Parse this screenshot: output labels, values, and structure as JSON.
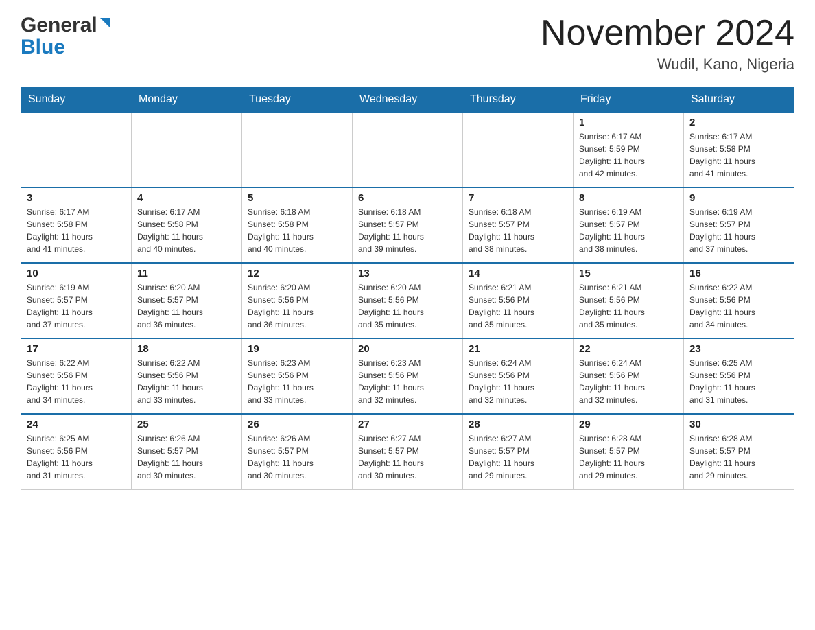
{
  "header": {
    "logo_general": "General",
    "logo_blue": "Blue",
    "title": "November 2024",
    "location": "Wudil, Kano, Nigeria"
  },
  "days_of_week": [
    "Sunday",
    "Monday",
    "Tuesday",
    "Wednesday",
    "Thursday",
    "Friday",
    "Saturday"
  ],
  "weeks": [
    {
      "days": [
        {
          "number": "",
          "info": ""
        },
        {
          "number": "",
          "info": ""
        },
        {
          "number": "",
          "info": ""
        },
        {
          "number": "",
          "info": ""
        },
        {
          "number": "",
          "info": ""
        },
        {
          "number": "1",
          "info": "Sunrise: 6:17 AM\nSunset: 5:59 PM\nDaylight: 11 hours\nand 42 minutes."
        },
        {
          "number": "2",
          "info": "Sunrise: 6:17 AM\nSunset: 5:58 PM\nDaylight: 11 hours\nand 41 minutes."
        }
      ]
    },
    {
      "days": [
        {
          "number": "3",
          "info": "Sunrise: 6:17 AM\nSunset: 5:58 PM\nDaylight: 11 hours\nand 41 minutes."
        },
        {
          "number": "4",
          "info": "Sunrise: 6:17 AM\nSunset: 5:58 PM\nDaylight: 11 hours\nand 40 minutes."
        },
        {
          "number": "5",
          "info": "Sunrise: 6:18 AM\nSunset: 5:58 PM\nDaylight: 11 hours\nand 40 minutes."
        },
        {
          "number": "6",
          "info": "Sunrise: 6:18 AM\nSunset: 5:57 PM\nDaylight: 11 hours\nand 39 minutes."
        },
        {
          "number": "7",
          "info": "Sunrise: 6:18 AM\nSunset: 5:57 PM\nDaylight: 11 hours\nand 38 minutes."
        },
        {
          "number": "8",
          "info": "Sunrise: 6:19 AM\nSunset: 5:57 PM\nDaylight: 11 hours\nand 38 minutes."
        },
        {
          "number": "9",
          "info": "Sunrise: 6:19 AM\nSunset: 5:57 PM\nDaylight: 11 hours\nand 37 minutes."
        }
      ]
    },
    {
      "days": [
        {
          "number": "10",
          "info": "Sunrise: 6:19 AM\nSunset: 5:57 PM\nDaylight: 11 hours\nand 37 minutes."
        },
        {
          "number": "11",
          "info": "Sunrise: 6:20 AM\nSunset: 5:57 PM\nDaylight: 11 hours\nand 36 minutes."
        },
        {
          "number": "12",
          "info": "Sunrise: 6:20 AM\nSunset: 5:56 PM\nDaylight: 11 hours\nand 36 minutes."
        },
        {
          "number": "13",
          "info": "Sunrise: 6:20 AM\nSunset: 5:56 PM\nDaylight: 11 hours\nand 35 minutes."
        },
        {
          "number": "14",
          "info": "Sunrise: 6:21 AM\nSunset: 5:56 PM\nDaylight: 11 hours\nand 35 minutes."
        },
        {
          "number": "15",
          "info": "Sunrise: 6:21 AM\nSunset: 5:56 PM\nDaylight: 11 hours\nand 35 minutes."
        },
        {
          "number": "16",
          "info": "Sunrise: 6:22 AM\nSunset: 5:56 PM\nDaylight: 11 hours\nand 34 minutes."
        }
      ]
    },
    {
      "days": [
        {
          "number": "17",
          "info": "Sunrise: 6:22 AM\nSunset: 5:56 PM\nDaylight: 11 hours\nand 34 minutes."
        },
        {
          "number": "18",
          "info": "Sunrise: 6:22 AM\nSunset: 5:56 PM\nDaylight: 11 hours\nand 33 minutes."
        },
        {
          "number": "19",
          "info": "Sunrise: 6:23 AM\nSunset: 5:56 PM\nDaylight: 11 hours\nand 33 minutes."
        },
        {
          "number": "20",
          "info": "Sunrise: 6:23 AM\nSunset: 5:56 PM\nDaylight: 11 hours\nand 32 minutes."
        },
        {
          "number": "21",
          "info": "Sunrise: 6:24 AM\nSunset: 5:56 PM\nDaylight: 11 hours\nand 32 minutes."
        },
        {
          "number": "22",
          "info": "Sunrise: 6:24 AM\nSunset: 5:56 PM\nDaylight: 11 hours\nand 32 minutes."
        },
        {
          "number": "23",
          "info": "Sunrise: 6:25 AM\nSunset: 5:56 PM\nDaylight: 11 hours\nand 31 minutes."
        }
      ]
    },
    {
      "days": [
        {
          "number": "24",
          "info": "Sunrise: 6:25 AM\nSunset: 5:56 PM\nDaylight: 11 hours\nand 31 minutes."
        },
        {
          "number": "25",
          "info": "Sunrise: 6:26 AM\nSunset: 5:57 PM\nDaylight: 11 hours\nand 30 minutes."
        },
        {
          "number": "26",
          "info": "Sunrise: 6:26 AM\nSunset: 5:57 PM\nDaylight: 11 hours\nand 30 minutes."
        },
        {
          "number": "27",
          "info": "Sunrise: 6:27 AM\nSunset: 5:57 PM\nDaylight: 11 hours\nand 30 minutes."
        },
        {
          "number": "28",
          "info": "Sunrise: 6:27 AM\nSunset: 5:57 PM\nDaylight: 11 hours\nand 29 minutes."
        },
        {
          "number": "29",
          "info": "Sunrise: 6:28 AM\nSunset: 5:57 PM\nDaylight: 11 hours\nand 29 minutes."
        },
        {
          "number": "30",
          "info": "Sunrise: 6:28 AM\nSunset: 5:57 PM\nDaylight: 11 hours\nand 29 minutes."
        }
      ]
    }
  ]
}
